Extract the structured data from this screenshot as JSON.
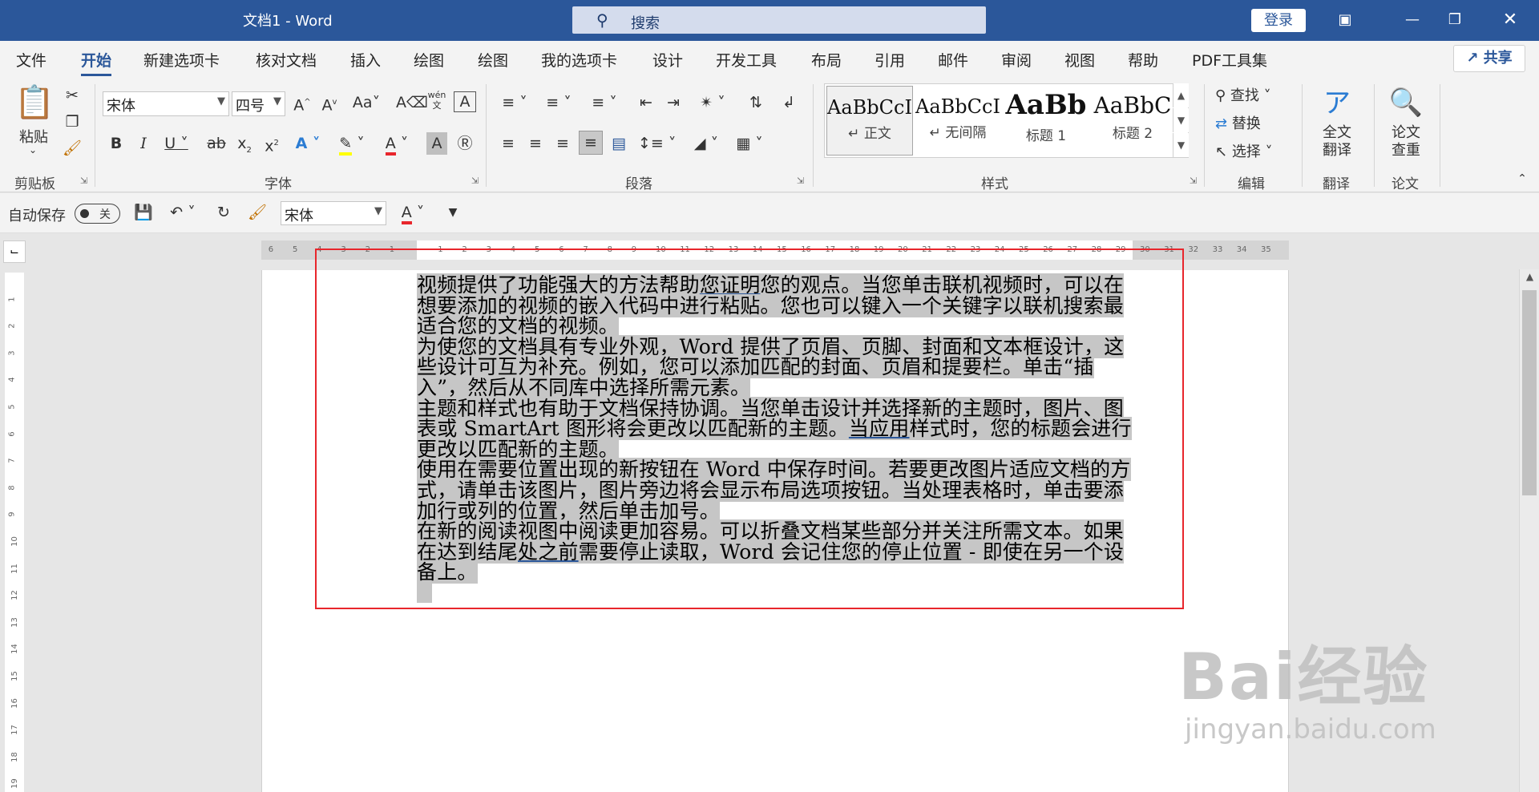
{
  "window": {
    "title": "文档1  -  Word",
    "search_placeholder": "搜索",
    "login": "登录"
  },
  "tabs": [
    "文件",
    "开始",
    "新建选项卡",
    "核对文档",
    "插入",
    "绘图",
    "绘图",
    "我的选项卡",
    "设计",
    "开发工具",
    "布局",
    "引用",
    "邮件",
    "审阅",
    "视图",
    "帮助",
    "PDF工具集"
  ],
  "share": "共享",
  "ribbon": {
    "clipboard": {
      "label": "剪贴板",
      "paste": "粘贴"
    },
    "font": {
      "label": "字体",
      "name": "宋体",
      "size": "四号"
    },
    "paragraph": {
      "label": "段落"
    },
    "styles": {
      "label": "样式",
      "items": [
        {
          "preview": "AaBbCcI",
          "name": "↵ 正文"
        },
        {
          "preview": "AaBbCcI",
          "name": "↵ 无间隔"
        },
        {
          "preview": "AaBb",
          "name": "标题 1"
        },
        {
          "preview": "AaBbC",
          "name": "标题 2"
        }
      ]
    },
    "editing": {
      "label": "编辑",
      "find": "查找",
      "replace": "替换",
      "select": "选择"
    },
    "translate": {
      "label": "翻译",
      "button_line1": "全文",
      "button_line2": "翻译"
    },
    "paper": {
      "label": "论文",
      "button_line1": "论文",
      "button_line2": "查重"
    }
  },
  "qat": {
    "autosave_label": "自动保存",
    "autosave_state": "关",
    "font": "宋体"
  },
  "document": {
    "paragraphs": [
      [
        "视频提供了功能强大的方法帮助",
        "您证明",
        "您的观点。当您单击联机视频时，可以在想要添加的视频的嵌入代码中进行粘贴。您也可以键入一个关键字以联机搜索最适合您的文档的视频。"
      ],
      [
        "为使您的文档具有专业外观，Word 提供了页眉、页脚、封面和文本框设计，这些设计可互为补充。例如，您可以添加匹配的封面、页眉和提要栏。单击“插入”，然后从不同库中选择所需元素。"
      ],
      [
        "主题和样式也有助于文档保持协调。当您单击设计并选择新的主题时，图片、图表或 SmartArt 图形将会更改以匹配新的主题。",
        "当应用",
        "样式时，您的标题会进行更改以匹配新的主题。"
      ],
      [
        "使用在需要位置出现的新按钮在 Word 中保存时间。若要更改图片适应文档的方式，请单击该图片，图片旁边将会显示布局选项按钮。当处理表格时，单击要添加行或列的位置，然后单击加号。"
      ],
      [
        "在新的阅读视图中阅读更加容易。可以折叠文档某些部分并关注所需文本。如果在达到结尾",
        "处之前",
        "需要停止读取，Word 会记住您的停止位置 - 即使在另一个设备上。"
      ]
    ]
  },
  "watermark": {
    "brand": "Bai经验",
    "url": "jingyan.baidu.com"
  },
  "colors": {
    "titlebar": "#2b579a",
    "selection": "#c6c6c6",
    "highlight_box": "#e8262c"
  }
}
